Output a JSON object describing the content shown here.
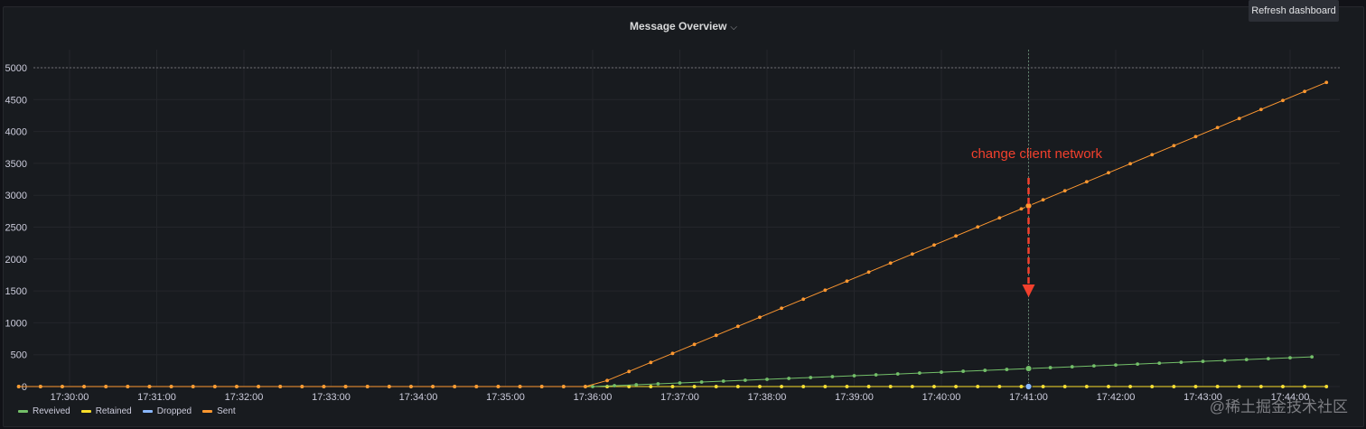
{
  "panel": {
    "title": "Message Overview",
    "menu_indicator": "⌵",
    "refresh_label": "Refresh dashboard"
  },
  "watermark": "@稀土掘金技术社区",
  "colors": {
    "Reveived": "#73bf69",
    "Retained": "#fade2a",
    "Dropped": "#8ab8ff",
    "Sent": "#ff9830",
    "annotation": "#f2402d"
  },
  "chart_data": {
    "type": "line",
    "title": "Message Overview",
    "x_tick_labels": [
      "17:30:00",
      "17:31:00",
      "17:32:00",
      "17:33:00",
      "17:34:00",
      "17:35:00",
      "17:36:00",
      "17:37:00",
      "17:38:00",
      "17:39:00",
      "17:40:00",
      "17:41:00",
      "17:42:00",
      "17:43:00",
      "17:44:00"
    ],
    "y_tick_labels": [
      "0",
      "500",
      "1000",
      "1500",
      "2000",
      "2500",
      "3000",
      "3500",
      "4000",
      "4500",
      "5000"
    ],
    "ylim": [
      0,
      5000
    ],
    "x_start": "17:29:25",
    "x_end": "17:44:25",
    "x_step_seconds": 15,
    "grid": true,
    "legend_position": "bottom-left",
    "series": [
      {
        "name": "Reveived",
        "start_time": "17:36:00",
        "start_value": 0,
        "end_time": "17:44:25",
        "end_value": 475
      },
      {
        "name": "Retained",
        "start_time": "17:29:25",
        "start_value": 0,
        "end_time": "17:44:25",
        "end_value": 0
      },
      {
        "name": "Dropped",
        "start_time": "17:29:25",
        "start_value": 0,
        "end_time": "17:44:25",
        "end_value": 0
      },
      {
        "name": "Sent",
        "start_time": "17:29:25",
        "start_value": 0,
        "flat_until": "17:36:00",
        "end_time": "17:44:25",
        "end_value": 4770
      }
    ],
    "threshold_line": 5000,
    "hover_time": "17:41:00",
    "annotation": {
      "text": "change client network",
      "time": "17:41:00"
    }
  }
}
